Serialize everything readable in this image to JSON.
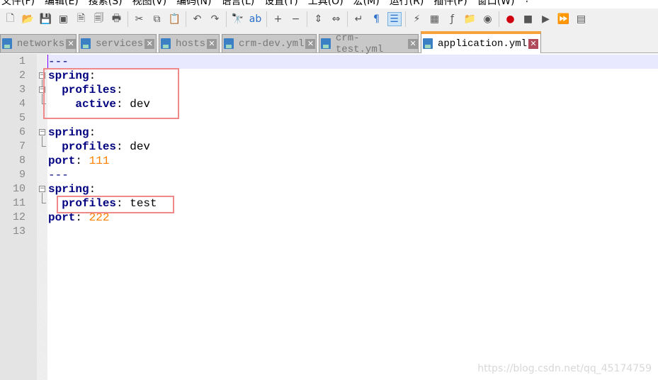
{
  "menu": [
    "文件(F)",
    "编辑(E)",
    "搜索(S)",
    "视图(V)",
    "编码(N)",
    "语言(L)",
    "设置(T)",
    "工具(O)",
    "宏(M)",
    "运行(R)",
    "插件(P)",
    "窗口(W)",
    "?"
  ],
  "toolbar": [
    "new-file",
    "open-file",
    "save",
    "save-all",
    "close",
    "close-all",
    "print",
    "|",
    "cut",
    "copy",
    "paste",
    "|",
    "undo",
    "redo",
    "|",
    "find",
    "replace",
    "|",
    "zoom-in",
    "zoom-out",
    "|",
    "sync-vertical",
    "sync-horizontal",
    "|",
    "word-wrap",
    "show-all-chars",
    "indent-guide",
    "|",
    "udl",
    "doc-map",
    "function-list",
    "folder-workspace",
    "monitor",
    "|",
    "record-macro",
    "stop-record",
    "play-macro",
    "run-macro-multiple",
    "save-macro"
  ],
  "tabs": [
    {
      "label": "networks",
      "active": false
    },
    {
      "label": "services",
      "active": false
    },
    {
      "label": "hosts",
      "active": false
    },
    {
      "label": "crm-dev.yml",
      "active": false
    },
    {
      "label": "crm-test.yml",
      "active": false
    },
    {
      "label": "application.yml",
      "active": true
    }
  ],
  "lines": [
    {
      "n": "1",
      "parts": [
        {
          "t": "---",
          "c": "dash"
        }
      ]
    },
    {
      "n": "2",
      "parts": [
        {
          "t": "spring",
          "c": "key"
        },
        {
          "t": ":",
          "c": ""
        }
      ]
    },
    {
      "n": "3",
      "parts": [
        {
          "t": "  ",
          "c": ""
        },
        {
          "t": "profiles",
          "c": "key"
        },
        {
          "t": ":",
          "c": ""
        }
      ]
    },
    {
      "n": "4",
      "parts": [
        {
          "t": "    ",
          "c": ""
        },
        {
          "t": "active",
          "c": "key"
        },
        {
          "t": ": dev",
          "c": ""
        }
      ]
    },
    {
      "n": "5",
      "parts": [
        {
          "t": "---",
          "c": "dash"
        }
      ]
    },
    {
      "n": "6",
      "parts": [
        {
          "t": "spring",
          "c": "key"
        },
        {
          "t": ":",
          "c": ""
        }
      ]
    },
    {
      "n": "7",
      "parts": [
        {
          "t": "  ",
          "c": ""
        },
        {
          "t": "profiles",
          "c": "key"
        },
        {
          "t": ": dev",
          "c": ""
        }
      ]
    },
    {
      "n": "8",
      "parts": [
        {
          "t": "port",
          "c": "key"
        },
        {
          "t": ": ",
          "c": ""
        },
        {
          "t": "111",
          "c": "num"
        }
      ]
    },
    {
      "n": "9",
      "parts": [
        {
          "t": "---",
          "c": "dash"
        }
      ]
    },
    {
      "n": "10",
      "parts": [
        {
          "t": "spring",
          "c": "key"
        },
        {
          "t": ":",
          "c": ""
        }
      ]
    },
    {
      "n": "11",
      "parts": [
        {
          "t": "  ",
          "c": ""
        },
        {
          "t": "profiles",
          "c": "key"
        },
        {
          "t": ": test",
          "c": ""
        }
      ]
    },
    {
      "n": "12",
      "parts": [
        {
          "t": "port",
          "c": "key"
        },
        {
          "t": ": ",
          "c": ""
        },
        {
          "t": "222",
          "c": "num"
        }
      ]
    },
    {
      "n": "13",
      "parts": []
    }
  ],
  "watermark": "https://blog.csdn.net/qq_45174759"
}
